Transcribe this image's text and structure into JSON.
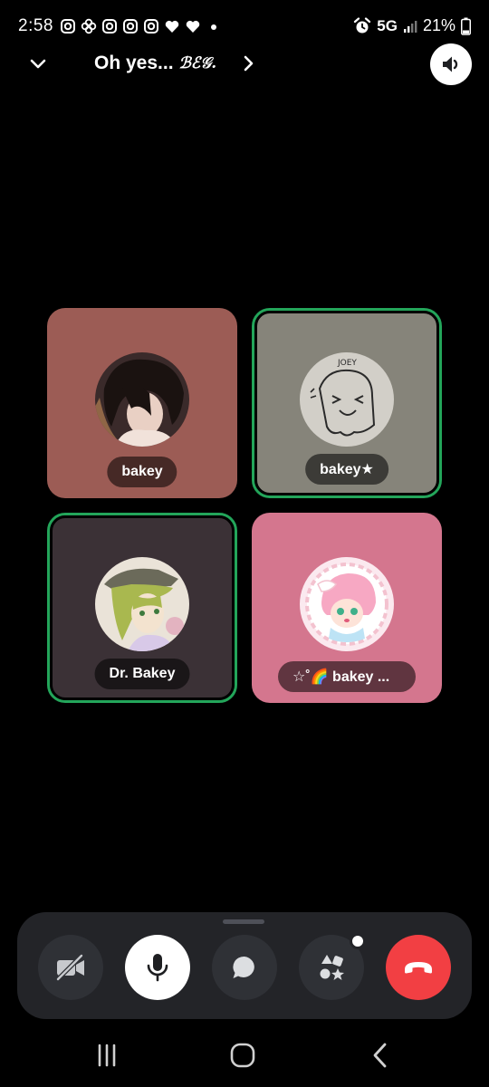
{
  "status_bar": {
    "time": "2:58",
    "network": "5G",
    "battery": "21%",
    "notification_icons": [
      "instagram-icon",
      "pinwheel-icon",
      "instagram-icon",
      "instagram-icon",
      "instagram-icon",
      "heart-icon",
      "heart-icon",
      "dot-icon"
    ]
  },
  "header": {
    "title": "Oh yes...",
    "title_suffix": "ℬℰ𝒢."
  },
  "participants": [
    {
      "name": "bakey",
      "tile_color": "#9c5c55",
      "speaking": false
    },
    {
      "name": "bakey★",
      "tile_color": "#86847a",
      "speaking": true
    },
    {
      "name": "Dr. Bakey",
      "tile_color": "#3b3136",
      "speaking": true
    },
    {
      "name": "☆˚🌈 bakey ...",
      "tile_color": "#d4768e",
      "speaking": false
    }
  ],
  "controls": [
    {
      "name": "camera-off",
      "label": ""
    },
    {
      "name": "microphone",
      "label": ""
    },
    {
      "name": "chat",
      "label": ""
    },
    {
      "name": "activities",
      "label": ""
    },
    {
      "name": "end-call",
      "label": ""
    }
  ],
  "colors": {
    "background": "#000000",
    "control_bar": "#232428",
    "control_button": "#2f3136",
    "end_call": "#f23f43",
    "speaking_ring": "#23a55a"
  }
}
